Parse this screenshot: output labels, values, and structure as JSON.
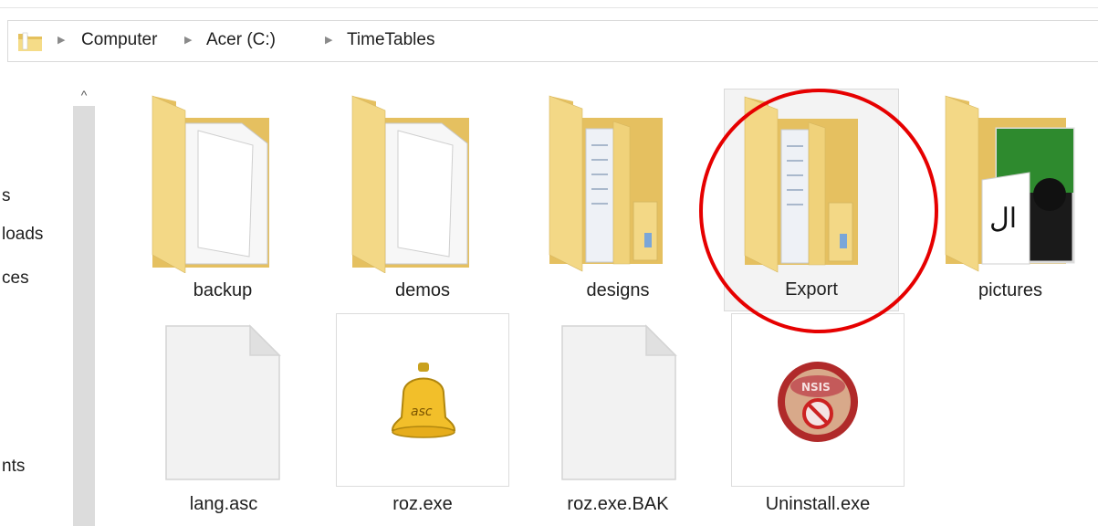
{
  "breadcrumb": {
    "items": [
      "Computer",
      "Acer (C:)",
      "TimeTables"
    ],
    "separator": "▶"
  },
  "nav_pane": {
    "visible_fragments": [
      "s",
      "loads",
      "ces",
      "nts"
    ],
    "scroll_up_glyph": "^"
  },
  "files": [
    {
      "name": "backup",
      "type": "folder",
      "selected": false
    },
    {
      "name": "demos",
      "type": "folder",
      "selected": false
    },
    {
      "name": "designs",
      "type": "folder",
      "selected": false
    },
    {
      "name": "Export",
      "type": "folder",
      "selected": true
    },
    {
      "name": "pictures",
      "type": "folder",
      "selected": false
    },
    {
      "name": "lang.asc",
      "type": "file",
      "selected": false
    },
    {
      "name": "roz.exe",
      "type": "file",
      "selected": false
    },
    {
      "name": "roz.exe.BAK",
      "type": "file",
      "selected": false
    },
    {
      "name": "Uninstall.exe",
      "type": "file",
      "selected": false
    }
  ],
  "icons": {
    "roz_exe": {
      "name": "bell-icon",
      "text": "asc"
    },
    "uninstall_exe": {
      "name": "uninstall-no-icon",
      "text": "NSIS"
    }
  },
  "colors": {
    "folder_back": "#e8c96a",
    "folder_front": "#f6df8f",
    "highlight": "#e60000",
    "selection_bg": "#f3f3f3"
  }
}
